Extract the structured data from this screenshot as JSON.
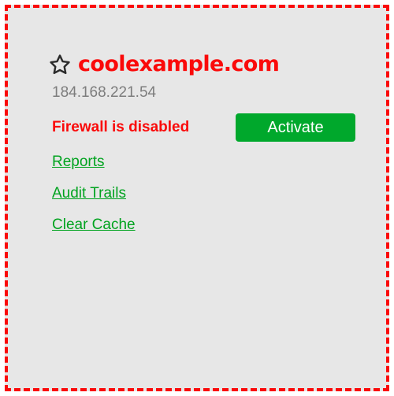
{
  "panel": {
    "border_color": "#fa0a0a",
    "background_color": "#e7e7e7"
  },
  "header": {
    "star_icon": "star-outline-icon",
    "brand_name": "coolexample.com",
    "brand_color": "#fa0a0a"
  },
  "server": {
    "ip_address": "184.168.221.54"
  },
  "firewall": {
    "status_text": "Firewall is disabled",
    "status_color": "#fa0a0a",
    "activate_label": "Activate",
    "activate_color": "#00a82c"
  },
  "links": [
    {
      "label": "Reports"
    },
    {
      "label": "Audit Trails"
    },
    {
      "label": "Clear Cache"
    }
  ],
  "link_color": "#00a31f"
}
